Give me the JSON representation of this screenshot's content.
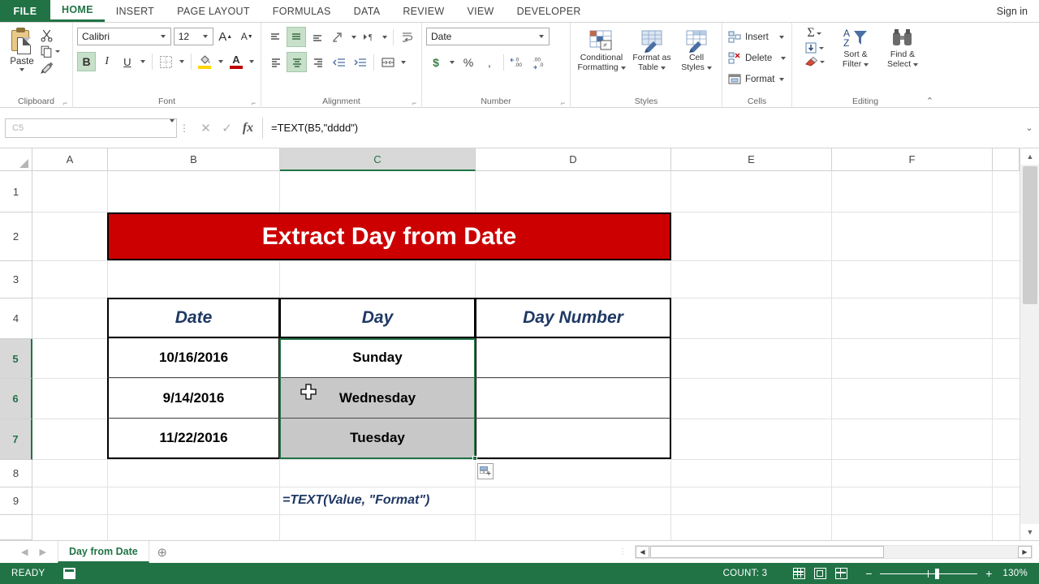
{
  "window": {
    "signin_label": "Sign in"
  },
  "tabs": {
    "file_label": "FILE",
    "items": [
      {
        "label": "HOME",
        "active": true
      },
      {
        "label": "INSERT",
        "active": false
      },
      {
        "label": "PAGE LAYOUT",
        "active": false
      },
      {
        "label": "FORMULAS",
        "active": false
      },
      {
        "label": "DATA",
        "active": false
      },
      {
        "label": "REVIEW",
        "active": false
      },
      {
        "label": "VIEW",
        "active": false
      },
      {
        "label": "DEVELOPER",
        "active": false
      }
    ]
  },
  "ribbon": {
    "clipboard": {
      "group_label": "Clipboard",
      "paste_label": "Paste",
      "cut_label": "Cut",
      "copy_label": "Copy",
      "format_painter_label": "Format Painter"
    },
    "font": {
      "group_label": "Font",
      "font_name": "Calibri",
      "font_size": "12",
      "grow_label": "A",
      "shrink_label": "A",
      "bold_label": "B",
      "italic_label": "I",
      "underline_label": "U",
      "borders_label": "Borders",
      "fill_color_label": "A",
      "font_color_label": "A",
      "fill_color": "#ffd400",
      "font_color": "#c00000",
      "bold_active": true
    },
    "alignment": {
      "group_label": "Alignment",
      "top_align_label": "Top Align",
      "middle_align_label": "Middle Align",
      "bottom_align_label": "Bottom Align",
      "orientation_label": "Orientation",
      "text_direction_label": "Text Direction",
      "align_left_label": "Align Left",
      "align_center_label": "Center",
      "align_right_label": "Align Right",
      "decrease_indent_label": "Decrease Indent",
      "increase_indent_label": "Increase Indent",
      "wrap_text_label": "Wrap Text",
      "merge_center_label": "Merge & Center"
    },
    "number": {
      "group_label": "Number",
      "format_value": "Date",
      "currency_label": "$",
      "percent_label": "%",
      "comma_label": ",",
      "increase_decimal_label": ".00",
      "decrease_decimal_label": ".00"
    },
    "styles": {
      "group_label": "Styles",
      "conditional_formatting_label": "Conditional\nFormatting",
      "conditional_formatting_line1": "Conditional",
      "conditional_formatting_line2": "Formatting",
      "format_as_table_line1": "Format as",
      "format_as_table_line2": "Table",
      "cell_styles_line1": "Cell",
      "cell_styles_line2": "Styles"
    },
    "cells": {
      "group_label": "Cells",
      "insert_label": "Insert",
      "delete_label": "Delete",
      "format_label": "Format"
    },
    "editing": {
      "group_label": "Editing",
      "autosum_label": "Σ",
      "fill_label": "Fill",
      "clear_label": "Clear",
      "sort_filter_line1": "Sort &",
      "sort_filter_line2": "Filter",
      "find_select_line1": "Find &",
      "find_select_line2": "Select"
    }
  },
  "formula_bar": {
    "name_box_value": "C5",
    "cancel_label": "✕",
    "enter_label": "✓",
    "fx_label": "fx",
    "formula_value": "=TEXT(B5,\"dddd\")"
  },
  "grid": {
    "columns": [
      "A",
      "B",
      "C",
      "D",
      "E",
      "F"
    ],
    "selected_column": "C",
    "rows": [
      "1",
      "2",
      "3",
      "4",
      "5",
      "6",
      "7",
      "8",
      "9"
    ],
    "selected_rows": [
      "5",
      "6",
      "7"
    ],
    "banner": {
      "text": "Extract Day from Date",
      "bg_color": "#cc0000",
      "text_color": "#ffffff",
      "range": "B2:D2"
    },
    "table": {
      "headers": [
        "Date",
        "Day",
        "Day Number"
      ],
      "header_color": "#1f3864",
      "rows": [
        {
          "date": "10/16/2016",
          "day": "Sunday",
          "day_number": ""
        },
        {
          "date": "9/14/2016",
          "day": "Wednesday",
          "day_number": ""
        },
        {
          "date": "11/22/2016",
          "day": "Tuesday",
          "day_number": ""
        }
      ]
    },
    "note": {
      "text": "=TEXT(Value, \"Format\")",
      "cell": "C9"
    }
  },
  "sheet_tabs": {
    "prev_label": "◀",
    "next_label": "▶",
    "tabs": [
      {
        "label": "Day from Date",
        "active": true
      }
    ],
    "add_label": "⊕"
  },
  "status_bar": {
    "mode": "READY",
    "macro_label": "Record Macro",
    "count_label": "COUNT: 3",
    "view_normal_label": "Normal",
    "view_page_layout_label": "Page Layout",
    "view_page_break_label": "Page Break Preview",
    "zoom_out_label": "−",
    "zoom_in_label": "+",
    "zoom_value": "130%"
  }
}
